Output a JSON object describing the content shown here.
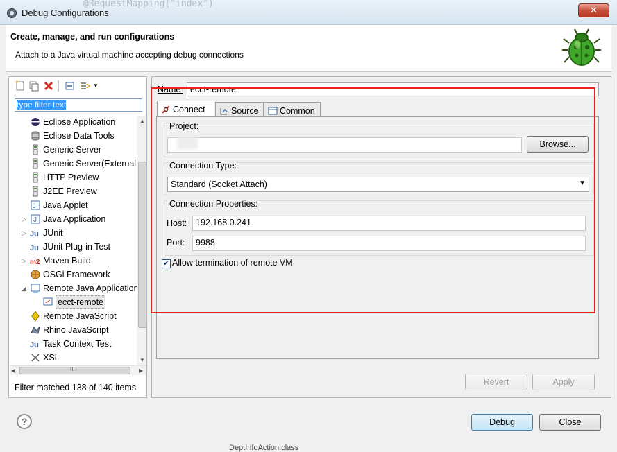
{
  "window": {
    "title": "Debug Configurations",
    "close_label": "✕",
    "background_code": "@RequestMapping(\"index\")"
  },
  "header": {
    "title": "Create, manage, and run configurations",
    "description": "Attach to a Java virtual machine accepting debug connections",
    "image_icon": "debug-bug-icon"
  },
  "left_panel": {
    "toolbar": {
      "icons": [
        "new-launch-configuration-icon",
        "duplicate-icon",
        "delete-icon",
        "collapse-all-icon",
        "filter-icon",
        "dropdown-arrow-icon"
      ],
      "dropdown_glyph": "▼"
    },
    "filter_placeholder": "type filter text",
    "tree": [
      {
        "label": "Eclipse Application",
        "icon": "eclipse-icon",
        "expander": ""
      },
      {
        "label": "Eclipse Data Tools",
        "icon": "database-icon",
        "expander": ""
      },
      {
        "label": "Generic Server",
        "icon": "server-icon",
        "expander": ""
      },
      {
        "label": "Generic Server(External Launch)",
        "icon": "server-icon",
        "expander": ""
      },
      {
        "label": "HTTP Preview",
        "icon": "server-icon",
        "expander": ""
      },
      {
        "label": "J2EE Preview",
        "icon": "server-icon",
        "expander": ""
      },
      {
        "label": "Java Applet",
        "icon": "java-applet-icon",
        "expander": ""
      },
      {
        "label": "Java Application",
        "icon": "java-application-icon",
        "expander": "▷"
      },
      {
        "label": "JUnit",
        "icon": "junit-icon",
        "expander": "▷"
      },
      {
        "label": "JUnit Plug-in Test",
        "icon": "junit-plugin-icon",
        "expander": ""
      },
      {
        "label": "Maven Build",
        "icon": "maven-icon",
        "expander": "▷"
      },
      {
        "label": "OSGi Framework",
        "icon": "osgi-icon",
        "expander": ""
      },
      {
        "label": "Remote Java Application",
        "icon": "remote-java-icon",
        "expander": "◢"
      },
      {
        "label": "ecct-remote",
        "icon": "remote-java-config-icon",
        "expander": ""
      },
      {
        "label": "Remote JavaScript",
        "icon": "javascript-icon",
        "expander": ""
      },
      {
        "label": "Rhino JavaScript",
        "icon": "rhino-icon",
        "expander": ""
      },
      {
        "label": "Task Context Test",
        "icon": "task-context-icon",
        "expander": ""
      },
      {
        "label": "XSL",
        "icon": "xsl-icon",
        "expander": ""
      }
    ],
    "scroll_up_glyph": "▲",
    "scroll_down_glyph": "▼",
    "scroll_left_glyph": "◀",
    "scroll_right_glyph": "▶",
    "scroll_grip": "III",
    "filter_status": "Filter matched 138 of 140 items"
  },
  "config": {
    "name_label": "Name:",
    "name_value": "ecct-remote",
    "tabs": [
      {
        "label": "Connect",
        "icon": "connect-icon"
      },
      {
        "label": "Source",
        "icon": "source-icon"
      },
      {
        "label": "Common",
        "icon": "common-icon"
      }
    ],
    "project_label": "Project:",
    "project_value": "",
    "browse_label": "Browse...",
    "connection_type_label": "Connection Type:",
    "connection_type_value": "Standard (Socket Attach)",
    "connection_properties_label": "Connection Properties:",
    "host_label": "Host:",
    "host_value": "192.168.0.241",
    "port_label": "Port:",
    "port_value": "9988",
    "allow_termination_label": "Allow termination of remote VM",
    "allow_termination_checked": true,
    "checkbox_glyph": "✔",
    "revert_label": "Revert",
    "apply_label": "Apply"
  },
  "footer": {
    "help_glyph": "?",
    "debug_label": "Debug",
    "close_label": "Close",
    "behind_text": "DeptInfoAction.class"
  },
  "colors": {
    "highlight_box": "#e8241c",
    "selection": "#3399ff"
  }
}
